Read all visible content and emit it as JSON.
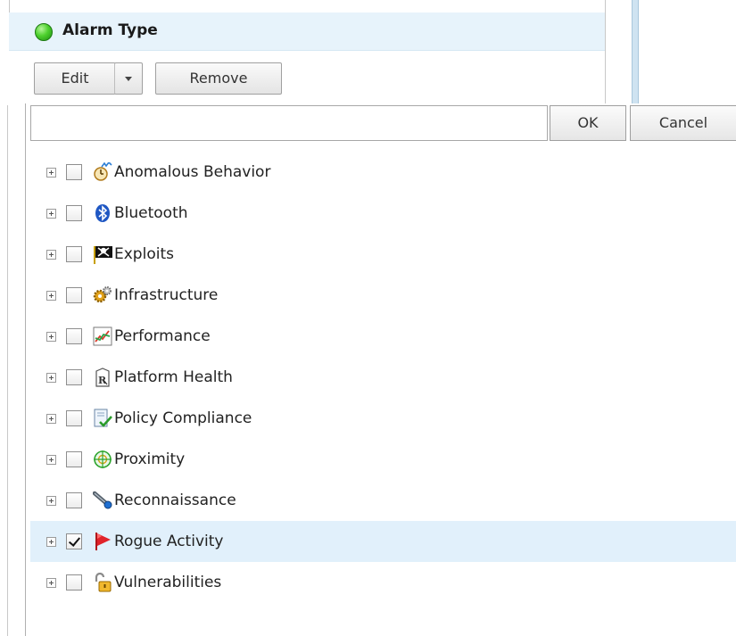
{
  "panel": {
    "title": "Alarm Type",
    "status_color": "#3cc21f"
  },
  "toolbar": {
    "edit_label": "Edit",
    "remove_label": "Remove"
  },
  "editor": {
    "filter_value": "",
    "ok_label": "OK",
    "cancel_label": "Cancel"
  },
  "tree": {
    "items": [
      {
        "label": "Anomalous Behavior",
        "icon": "anomaly-icon",
        "checked": false,
        "selected": false
      },
      {
        "label": "Bluetooth",
        "icon": "bluetooth-icon",
        "checked": false,
        "selected": false
      },
      {
        "label": "Exploits",
        "icon": "skull-flag-icon",
        "checked": false,
        "selected": false
      },
      {
        "label": "Infrastructure",
        "icon": "gears-icon",
        "checked": false,
        "selected": false
      },
      {
        "label": "Performance",
        "icon": "chart-line-icon",
        "checked": false,
        "selected": false
      },
      {
        "label": "Platform Health",
        "icon": "rx-icon",
        "checked": false,
        "selected": false
      },
      {
        "label": "Policy Compliance",
        "icon": "document-check-icon",
        "checked": false,
        "selected": false
      },
      {
        "label": "Proximity",
        "icon": "crosshair-icon",
        "checked": false,
        "selected": false
      },
      {
        "label": "Reconnaissance",
        "icon": "telescope-icon",
        "checked": false,
        "selected": false
      },
      {
        "label": "Rogue Activity",
        "icon": "red-flag-icon",
        "checked": true,
        "selected": true
      },
      {
        "label": "Vulnerabilities",
        "icon": "unlocked-padlock-icon",
        "checked": false,
        "selected": false
      }
    ]
  },
  "colors": {
    "selected_row": "#e1f0fb",
    "header_bg": "#e7f3fb"
  }
}
